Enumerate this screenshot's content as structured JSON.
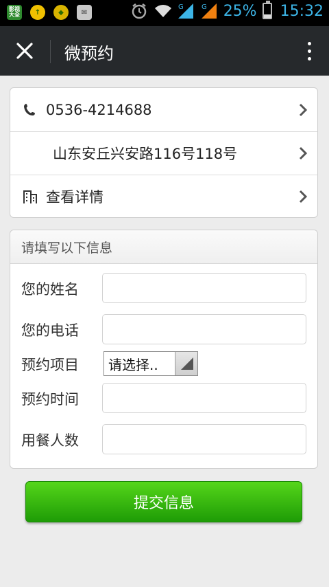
{
  "status_bar": {
    "app_icons": [
      "影视大全",
      "↑",
      "◆",
      "✉"
    ],
    "battery": "25%",
    "battery_level": 0.25,
    "time": "15:32",
    "network_label": "G"
  },
  "titlebar": {
    "title": "微预约"
  },
  "info": {
    "phone": "0536-4214688",
    "address": "山东安丘兴安路116号118号",
    "details": "查看详情"
  },
  "form": {
    "header": "请填写以下信息",
    "name_label": "您的姓名",
    "phone_label": "您的电话",
    "item_label": "预约项目",
    "item_select": "请选择..",
    "time_label": "预约时间",
    "people_label": "用餐人数"
  },
  "submit_label": "提交信息",
  "colors": {
    "titlebar": "#26292c",
    "accent_green": "#2db40c",
    "status_blue": "#3cb4e6"
  }
}
